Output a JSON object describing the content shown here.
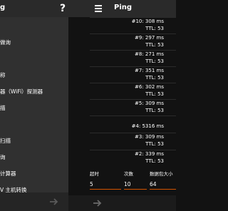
{
  "drawer": {
    "title": "g",
    "help": "?",
    "items": [
      {
        "label": ""
      },
      {
        "label": "做询"
      },
      {
        "label": ""
      },
      {
        "label": "称"
      },
      {
        "label": "器（WiFi）探测器"
      },
      {
        "label": "描"
      },
      {
        "label": ""
      },
      {
        "label": "扫描"
      },
      {
        "label": "询"
      },
      {
        "label": "计算器"
      },
      {
        "label": "V 主机转换"
      }
    ]
  },
  "appbar": {
    "title": "Ping"
  },
  "results": [
    {
      "line1": "#10: 308 ms",
      "line2": "TTL: 53"
    },
    {
      "line1": "#9: 297 ms",
      "line2": "TTL: 53"
    },
    {
      "line1": "#8: 271 ms",
      "line2": "TTL: 53"
    },
    {
      "line1": "#7: 351 ms",
      "line2": "TTL: 53"
    },
    {
      "line1": "#6: 302 ms",
      "line2": "TTL: 53"
    },
    {
      "line1": "#5: 309 ms",
      "line2": "TTL: 53"
    },
    {
      "line1": "#4: 5316 ms",
      "line2": ""
    },
    {
      "line1": "#3: 309 ms",
      "line2": "TTL: 53"
    },
    {
      "line1": "#2: 339 ms",
      "line2": "TTL: 53"
    }
  ],
  "params": {
    "timeout_label": "超时",
    "timeout_value": "5",
    "count_label": "次数",
    "count_value": "10",
    "size_label": "数据包大小",
    "size_value": "64"
  },
  "icons": {
    "menu": "hamburger-menu-icon",
    "run": "arrow-right-icon",
    "drawer_next": "arrow-right-icon"
  },
  "colors": {
    "accent": "#d35400",
    "background": "#121212",
    "drawer": "#303030",
    "appbar": "#2a2a2a"
  }
}
